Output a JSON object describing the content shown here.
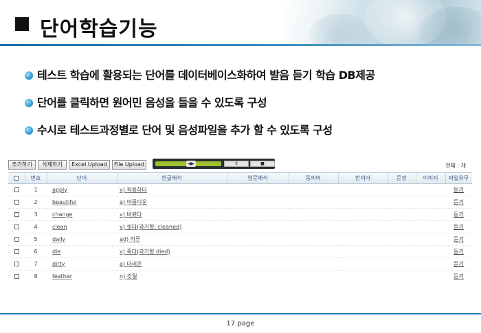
{
  "slide": {
    "title": "단어학습기능",
    "bullets": [
      "테스트 학습에 활용되는 단어를 데이터베이스화하여 발음 듣기 학습 DB제공",
      "단어를 클릭하면 원어민 음성을 들을 수 있도록 구성",
      "수시로 테스트과정별로 단어 및 음성파일을 추가 할 수 있도록 구성"
    ],
    "page_label": "17 page"
  },
  "toolbar": {
    "add_label": "추가하기",
    "delete_label": "삭제하기",
    "excel_label": "Excel Upload",
    "file_label": "File Upload",
    "total_label": "전체 : 개"
  },
  "player": {
    "pause_label": "II",
    "stop_label": "■",
    "progress": 0.55
  },
  "table": {
    "headers": [
      "번호",
      "단어",
      "한글해석",
      "영문해석",
      "동의어",
      "반의어",
      "문장",
      "이미지",
      "파일유무"
    ],
    "rows": [
      {
        "no": "1",
        "word": "apply",
        "meaning": "v) 적용하다",
        "listen": "듣기"
      },
      {
        "no": "2",
        "word": "beautiful",
        "meaning": "a) 아름다운",
        "listen": "듣기"
      },
      {
        "no": "3",
        "word": "change",
        "meaning": "v) 바뀌다",
        "listen": "듣기"
      },
      {
        "no": "4",
        "word": "clean",
        "meaning": "v) 씻다(과거형: cleaned)",
        "listen": "듣기"
      },
      {
        "no": "5",
        "word": "daily",
        "meaning": "ad) 하루",
        "listen": "듣기"
      },
      {
        "no": "6",
        "word": "die",
        "meaning": "v) 죽다(과거형:died)",
        "listen": "듣기"
      },
      {
        "no": "7",
        "word": "dirty",
        "meaning": "a) 더러운",
        "listen": "듣기"
      },
      {
        "no": "8",
        "word": "feather",
        "meaning": "n) 깃털",
        "listen": "듣기"
      }
    ]
  },
  "colors": {
    "accent": "#1a6fa6",
    "header_text": "#3c5d84",
    "player_track": "#9ec22e"
  }
}
